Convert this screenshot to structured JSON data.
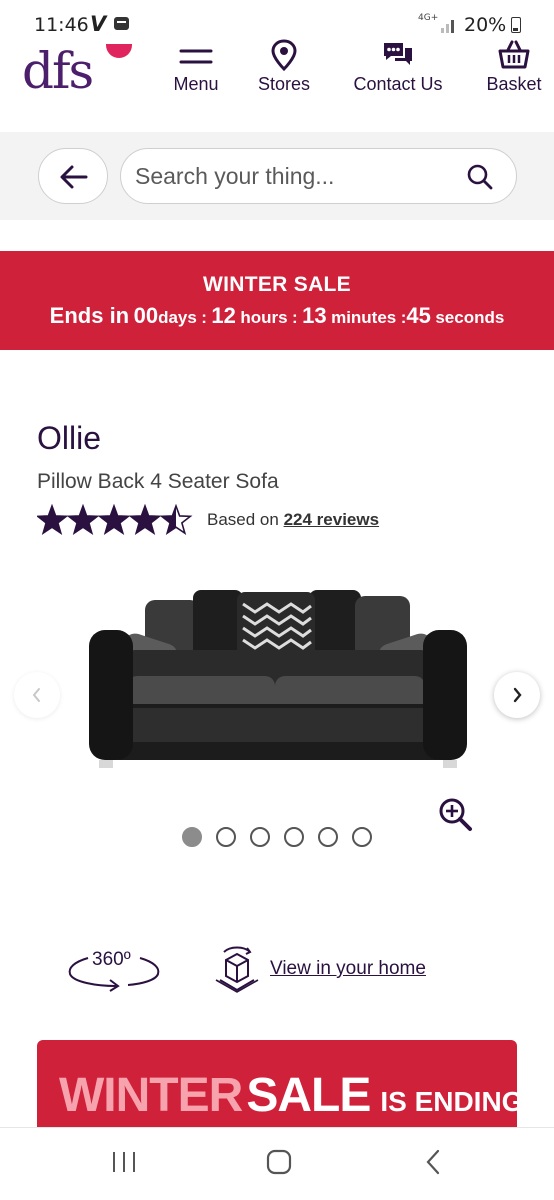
{
  "status_bar": {
    "time": "11:46",
    "carrier_icon": "V",
    "network": "4G+",
    "battery": "20%"
  },
  "header": {
    "logo": "dfs",
    "nav": [
      {
        "label": "Menu",
        "icon": "menu-icon"
      },
      {
        "label": "Stores",
        "icon": "location-pin-icon"
      },
      {
        "label": "Contact Us",
        "icon": "chat-icon"
      },
      {
        "label": "Basket",
        "icon": "basket-icon"
      }
    ]
  },
  "search": {
    "placeholder": "Search your thing..."
  },
  "sale_banner": {
    "title": "WINTER SALE",
    "prefix": "Ends in",
    "days_value": "00",
    "days_label": "days",
    "hours_value": "12",
    "hours_label": "hours",
    "minutes_value": "13",
    "minutes_label": "minutes",
    "seconds_value": "45",
    "seconds_label": "seconds",
    "separator": ":"
  },
  "product": {
    "name": "Ollie",
    "subtitle": "Pillow Back 4 Seater Sofa",
    "rating": 4.5,
    "rating_max": 5,
    "reviews_prefix": "Based on",
    "reviews_link": "224 reviews"
  },
  "carousel": {
    "total_images": 6,
    "active_index": 0
  },
  "features": {
    "view_360_label": "360º",
    "view_in_home_label": "View in your home"
  },
  "promo": {
    "word1": "WINTER",
    "word2": "SALE",
    "word3": "IS ENDING"
  },
  "colors": {
    "brand_purple": "#2a1140",
    "sale_red": "#d0213b",
    "logo_purple": "#4b1f6b",
    "logo_pink": "#e0245e"
  }
}
